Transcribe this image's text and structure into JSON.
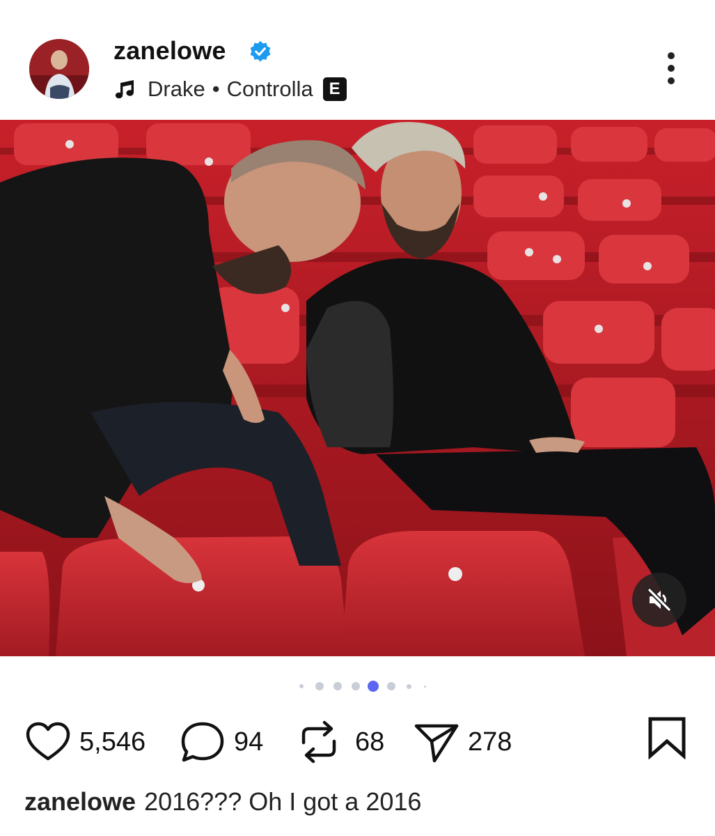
{
  "post": {
    "username": "zanelowe",
    "verified": true,
    "music": {
      "artist": "Drake",
      "separator": "•",
      "track": "Controlla",
      "explicit_badge": "E"
    }
  },
  "media": {
    "carousel": {
      "total": 7,
      "active_index": 4
    },
    "audio_muted": true
  },
  "actions": {
    "likes": "5,546",
    "comments": "94",
    "reposts": "68",
    "shares": "278"
  },
  "caption": {
    "username": "zanelowe",
    "text": "2016??? Oh I got a 2016"
  },
  "colors": {
    "verified": "#1d9bf0",
    "active_dot": "#5b67f0",
    "inactive_dot": "#c8cdd6",
    "seat_red": "#c3232b"
  },
  "icons": {
    "more": "more-vertical-icon",
    "music": "music-note-icon",
    "verified": "verified-badge-icon",
    "mute": "speaker-muted-icon",
    "like": "heart-icon",
    "comment": "comment-bubble-icon",
    "repost": "repost-icon",
    "share": "send-icon",
    "save": "bookmark-icon"
  }
}
